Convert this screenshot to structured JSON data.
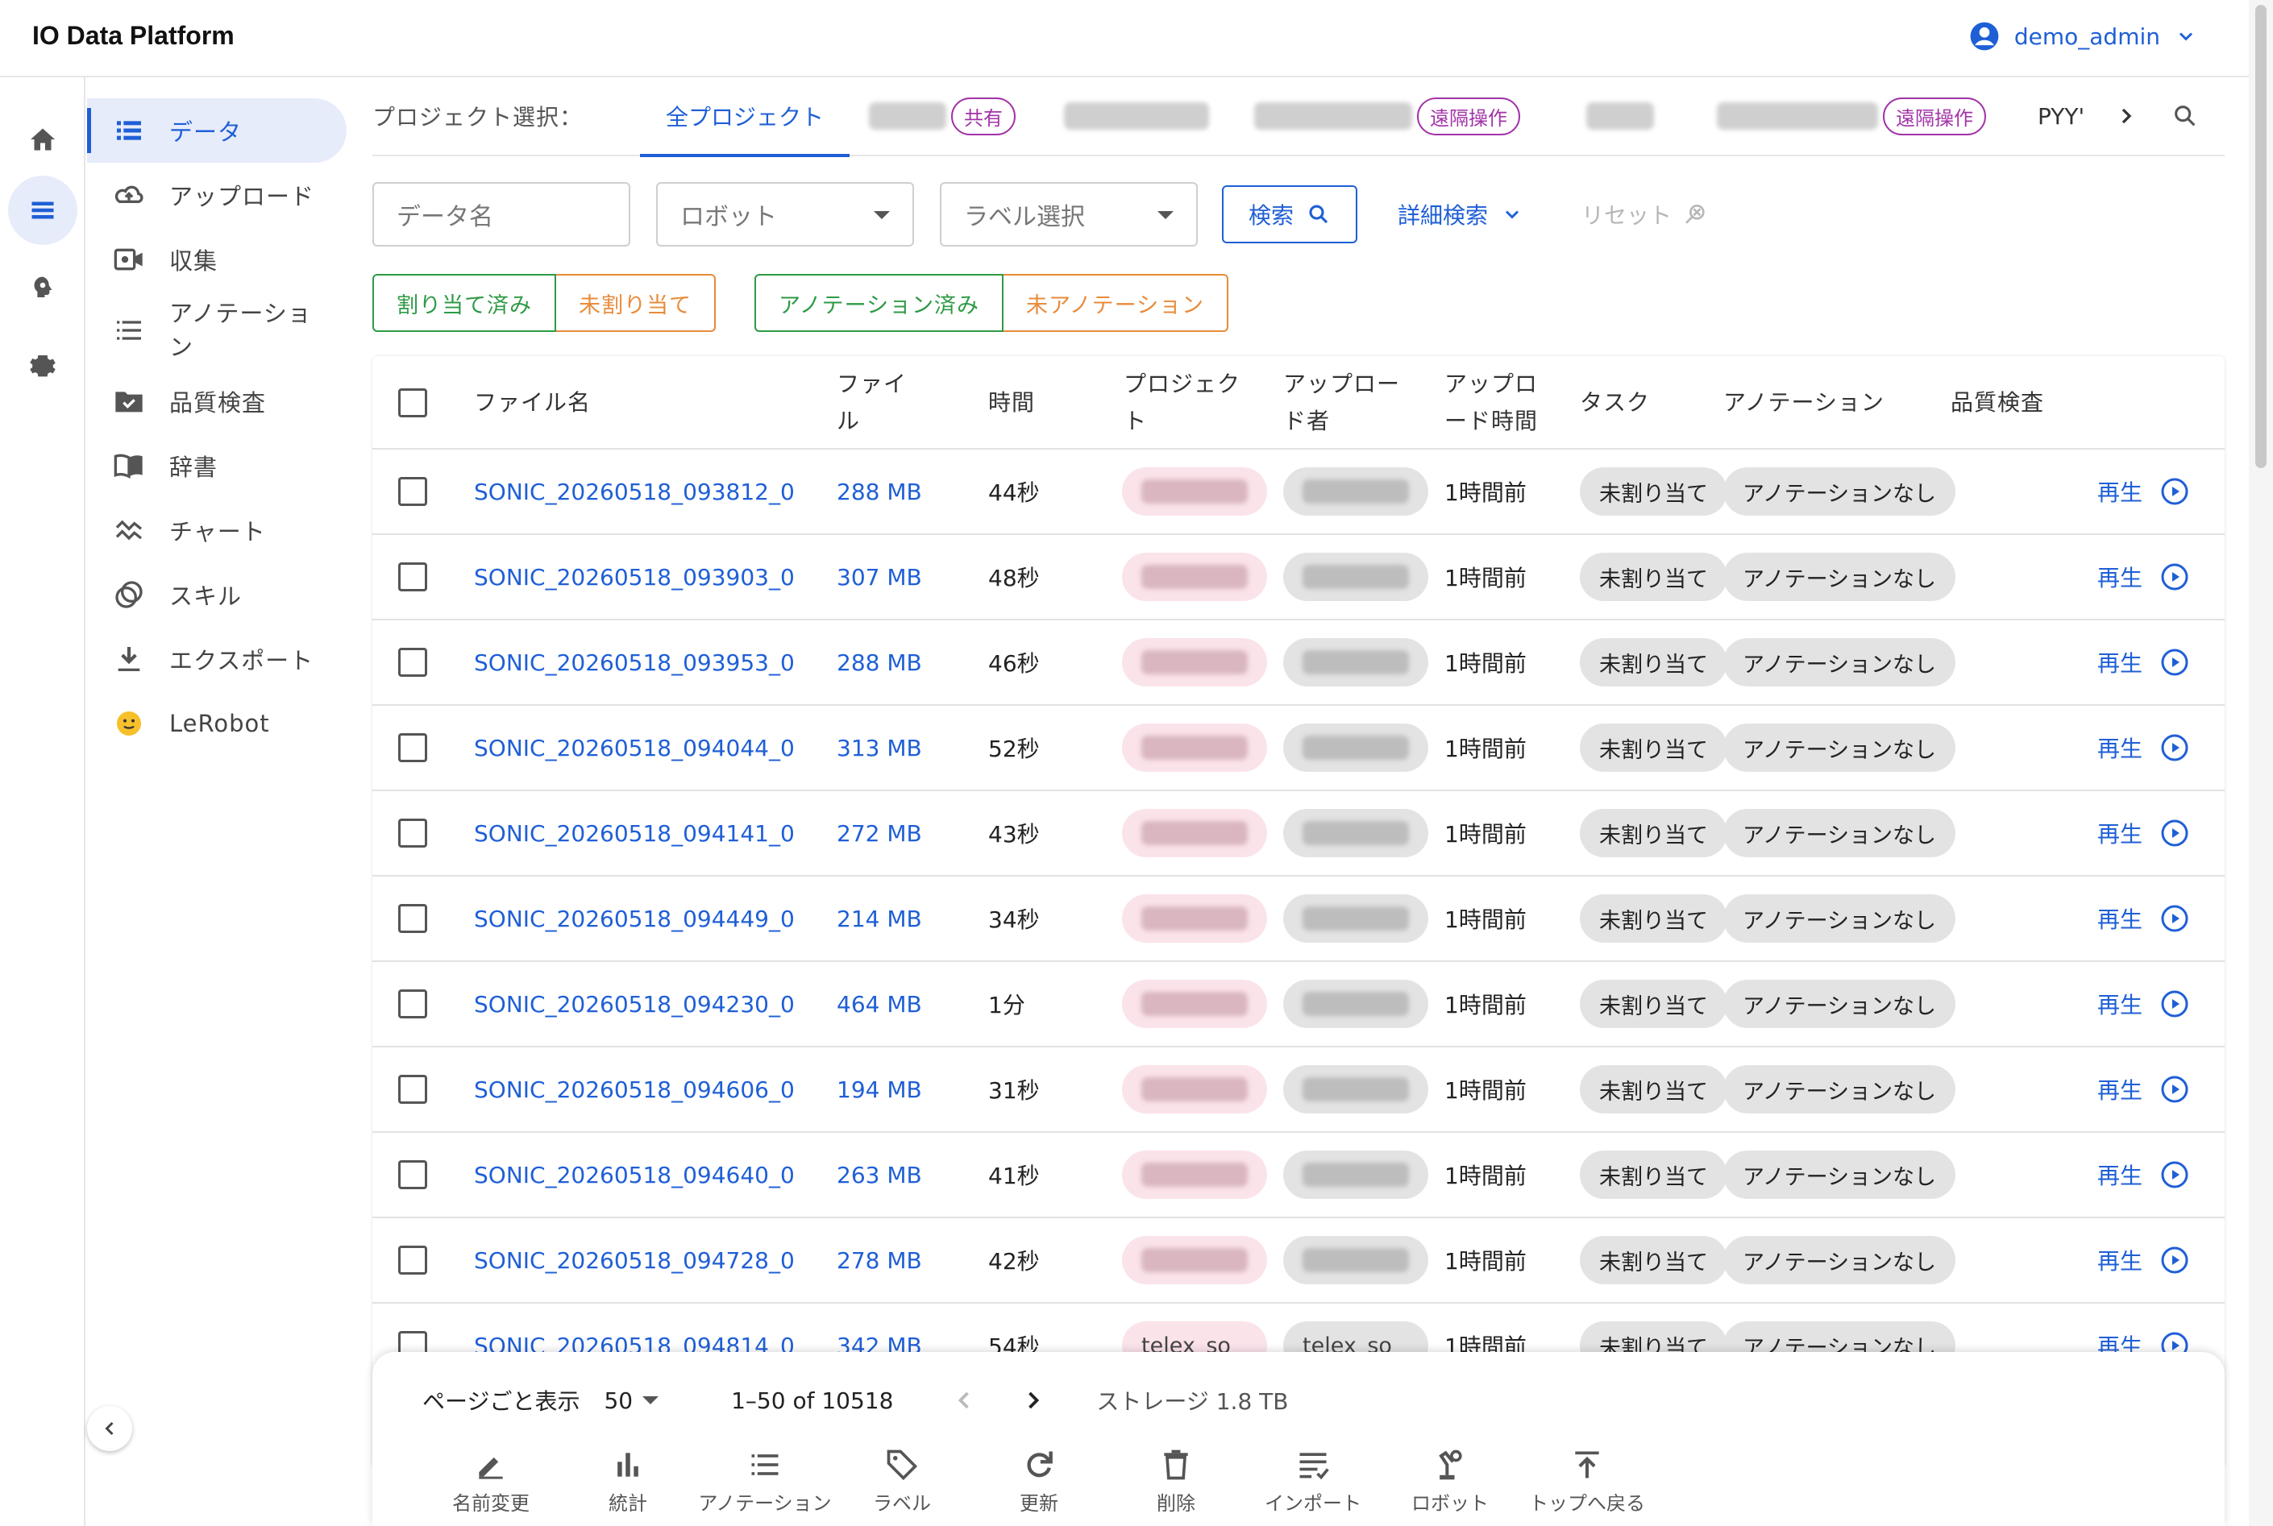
{
  "header": {
    "app_title": "IO Data Platform",
    "user_name": "demo_admin",
    "user_icon": "account-circle-icon"
  },
  "rail": {
    "items": [
      "home-icon",
      "list-icon",
      "brain-icon",
      "settings-icon"
    ],
    "active": 1
  },
  "sidebar": {
    "items": [
      {
        "label": "データ",
        "icon": "data-list-icon",
        "active": true
      },
      {
        "label": "アップロード",
        "icon": "cloud-upload-icon"
      },
      {
        "label": "収集",
        "icon": "video-record-icon"
      },
      {
        "label": "アノテーション",
        "icon": "list-numbered-icon"
      },
      {
        "label": "品質検査",
        "icon": "folder-check-icon"
      },
      {
        "label": "辞書",
        "icon": "book-icon"
      },
      {
        "label": "チャート",
        "icon": "chart-wave-icon"
      },
      {
        "label": "スキル",
        "icon": "skills-icon"
      },
      {
        "label": "エクスポート",
        "icon": "download-icon"
      },
      {
        "label": "LeRobot",
        "icon": "hugging-face-icon"
      }
    ]
  },
  "projects": {
    "label": "プロジェクト選択：",
    "all_label": "全プロジェクト",
    "tags": [
      "共有",
      "遠隔操作",
      "遠隔操作"
    ],
    "cut_label": "PYY'"
  },
  "filters": {
    "data_name": "データ名",
    "robot": "ロボット",
    "label_select": "ラベル選択",
    "search": "検索",
    "advanced": "詳細検索",
    "reset": "リセット"
  },
  "segments": {
    "assigned": "割り当て済み",
    "unassigned": "未割り当て",
    "annotated": "アノテーション済み",
    "not_annotated": "未アノテーション"
  },
  "table": {
    "columns": {
      "file": "ファイル名",
      "size": "ファイ\nル",
      "time": "時間",
      "project": "プロジェク\nト",
      "uploader": "アップロー\nド者",
      "upload_time": "アップロ\nード時間",
      "task": "タスク",
      "annotation": "アノテーション",
      "qc": "品質検査"
    },
    "rows": [
      {
        "file": "SONIC_20260518_093812_0",
        "size": "288 MB",
        "duration": "44秒",
        "uploaded": "1時間前",
        "task": "未割り当て",
        "annotation": "アノテーションなし",
        "play": "再生"
      },
      {
        "file": "SONIC_20260518_093903_0",
        "size": "307 MB",
        "duration": "48秒",
        "uploaded": "1時間前",
        "task": "未割り当て",
        "annotation": "アノテーションなし",
        "play": "再生"
      },
      {
        "file": "SONIC_20260518_093953_0",
        "size": "288 MB",
        "duration": "46秒",
        "uploaded": "1時間前",
        "task": "未割り当て",
        "annotation": "アノテーションなし",
        "play": "再生"
      },
      {
        "file": "SONIC_20260518_094044_0",
        "size": "313 MB",
        "duration": "52秒",
        "uploaded": "1時間前",
        "task": "未割り当て",
        "annotation": "アノテーションなし",
        "play": "再生"
      },
      {
        "file": "SONIC_20260518_094141_0",
        "size": "272 MB",
        "duration": "43秒",
        "uploaded": "1時間前",
        "task": "未割り当て",
        "annotation": "アノテーションなし",
        "play": "再生"
      },
      {
        "file": "SONIC_20260518_094449_0",
        "size": "214 MB",
        "duration": "34秒",
        "uploaded": "1時間前",
        "task": "未割り当て",
        "annotation": "アノテーションなし",
        "play": "再生"
      },
      {
        "file": "SONIC_20260518_094230_0",
        "size": "464 MB",
        "duration": "1分",
        "uploaded": "1時間前",
        "task": "未割り当て",
        "annotation": "アノテーションなし",
        "play": "再生"
      },
      {
        "file": "SONIC_20260518_094606_0",
        "size": "194 MB",
        "duration": "31秒",
        "uploaded": "1時間前",
        "task": "未割り当て",
        "annotation": "アノテーションなし",
        "play": "再生"
      },
      {
        "file": "SONIC_20260518_094640_0",
        "size": "263 MB",
        "duration": "41秒",
        "uploaded": "1時間前",
        "task": "未割り当て",
        "annotation": "アノテーションなし",
        "play": "再生"
      },
      {
        "file": "SONIC_20260518_094728_0",
        "size": "278 MB",
        "duration": "42秒",
        "uploaded": "1時間前",
        "task": "未割り当て",
        "annotation": "アノテーションなし",
        "play": "再生"
      },
      {
        "file": "SONIC_20260518_094814_0",
        "size": "342 MB",
        "duration": "54秒",
        "project": "telex_so",
        "uploader": "telex_so",
        "uploaded": "1時間前",
        "task": "未割り当て",
        "annotation": "アノテーションなし",
        "play": "再生"
      }
    ]
  },
  "pagination": {
    "per_page_label": "ページごと表示",
    "per_page": "50",
    "range": "1–50 of 10518",
    "storage": "ストレージ 1.8 TB"
  },
  "toolbar": [
    {
      "label": "名前変更",
      "icon": "rename-icon"
    },
    {
      "label": "統計",
      "icon": "bar-chart-icon"
    },
    {
      "label": "アノテーション",
      "icon": "list-numbered-icon"
    },
    {
      "label": "ラベル",
      "icon": "tag-icon"
    },
    {
      "label": "更新",
      "icon": "refresh-icon"
    },
    {
      "label": "削除",
      "icon": "trash-icon"
    },
    {
      "label": "インポート",
      "icon": "import-icon"
    },
    {
      "label": "ロボット",
      "icon": "robot-arm-icon"
    },
    {
      "label": "トップへ戻る",
      "icon": "to-top-icon"
    }
  ],
  "colors": {
    "accent": "#1f5fd6",
    "green": "#2e9a45",
    "orange": "#e88b3a",
    "purple": "#a233a8"
  }
}
